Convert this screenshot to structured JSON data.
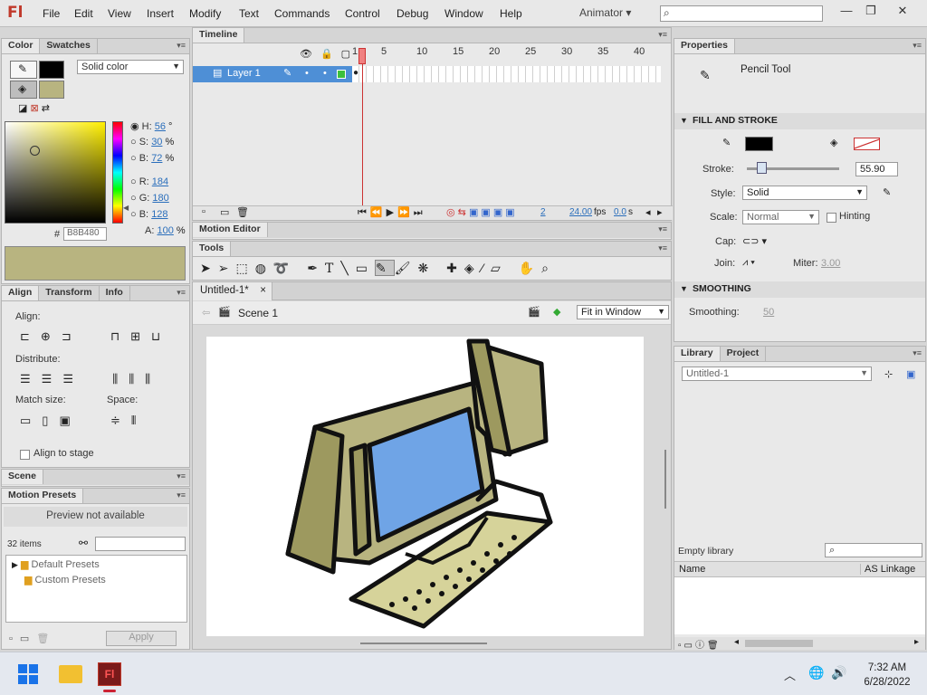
{
  "app": {
    "logo": "Fl",
    "workspace": "Animator ▾"
  },
  "menus": [
    "File",
    "Edit",
    "View",
    "Insert",
    "Modify",
    "Text",
    "Commands",
    "Control",
    "Debug",
    "Window",
    "Help"
  ],
  "window_controls": [
    "—",
    "❐",
    "✕"
  ],
  "color_panel": {
    "tabs": [
      "Color",
      "Swatches"
    ],
    "fill_type": "Solid color",
    "stroke_color": "#000000",
    "fill_color": "#b8b480",
    "h_label": "H:",
    "h": "56",
    "h_unit": "°",
    "s_label": "S:",
    "s": "30",
    "s_unit": "%",
    "b_label": "B:",
    "b": "72",
    "b_unit": "%",
    "r_label": "R:",
    "r": "184",
    "g_label": "G:",
    "g": "180",
    "b2_label": "B:",
    "b2": "128",
    "a_label": "A:",
    "alpha": "100",
    "alpha_unit": "%",
    "hex_label": "#",
    "hex": "B8B480"
  },
  "align_panel": {
    "tabs": [
      "Align",
      "Transform",
      "Info"
    ],
    "align_label": "Align:",
    "distribute_label": "Distribute:",
    "match_label": "Match size:",
    "space_label": "Space:",
    "stage_label": "Align to stage"
  },
  "scene_panel": {
    "tab": "Scene"
  },
  "motion_presets": {
    "tab": "Motion Presets",
    "preview": "Preview not available",
    "count": "32 items",
    "folders": [
      "Default Presets",
      "Custom Presets"
    ],
    "apply": "Apply"
  },
  "timeline": {
    "tab": "Timeline",
    "layer": "Layer 1",
    "ticks": [
      "1",
      "5",
      "10",
      "15",
      "20",
      "25",
      "30",
      "35",
      "40"
    ],
    "current_frame": "2",
    "fps": "24.00",
    "fps_unit": "fps",
    "time": "0.0",
    "time_unit": "s"
  },
  "motion_editor": {
    "tab": "Motion Editor"
  },
  "tools": {
    "tab": "Tools"
  },
  "document": {
    "tab": "Untitled-1*",
    "scene": "Scene 1",
    "zoom": "Fit in Window"
  },
  "properties": {
    "tab": "Properties",
    "tool": "Pencil Tool",
    "fill_stroke": "FILL AND STROKE",
    "stroke_label": "Stroke:",
    "stroke_value": "55.90",
    "stroke_level": 0.12,
    "style_label": "Style:",
    "style": "Solid",
    "scale_label": "Scale:",
    "scale": "Normal",
    "hinting": "Hinting",
    "cap_label": "Cap:",
    "join_label": "Join:",
    "miter_label": "Miter:",
    "miter": "3.00",
    "smoothing_head": "SMOOTHING",
    "smoothing_label": "Smoothing:",
    "smoothing": "50"
  },
  "library": {
    "tabs": [
      "Library",
      "Project"
    ],
    "doc": "Untitled-1",
    "empty": "Empty library",
    "col_name": "Name",
    "col_linkage": "AS Linkage"
  },
  "taskbar": {
    "time": "7:32 AM",
    "date": "6/28/2022",
    "app_icon": "Fl"
  }
}
